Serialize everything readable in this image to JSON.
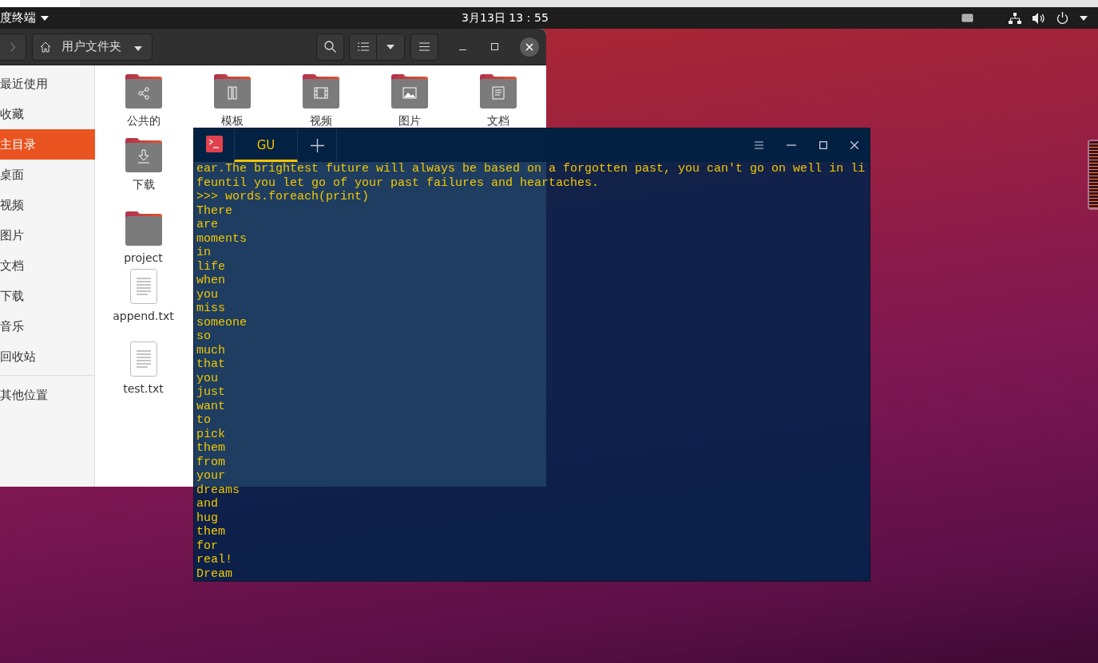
{
  "top_bar": {
    "app_menu": "度终端",
    "clock": "3月13日  13：55"
  },
  "file_manager": {
    "location": "用户文件夹",
    "sidebar": [
      {
        "label": "最近使用",
        "selected": false
      },
      {
        "label": "收藏",
        "selected": false
      },
      {
        "label": "主目录",
        "selected": true
      },
      {
        "label": "桌面",
        "selected": false
      },
      {
        "label": "视频",
        "selected": false
      },
      {
        "label": "图片",
        "selected": false
      },
      {
        "label": "文档",
        "selected": false
      },
      {
        "label": "下载",
        "selected": false
      },
      {
        "label": "音乐",
        "selected": false
      },
      {
        "label": "回收站",
        "selected": false
      },
      {
        "label": "其他位置",
        "selected": false
      }
    ],
    "files": [
      {
        "name": "公共的",
        "kind": "shared"
      },
      {
        "name": "模板",
        "kind": "templates"
      },
      {
        "name": "视频",
        "kind": "videos"
      },
      {
        "name": "图片",
        "kind": "pictures"
      },
      {
        "name": "文档",
        "kind": "documents"
      },
      {
        "name": "下载",
        "kind": "downloads"
      },
      {
        "name": "project",
        "kind": "folder"
      },
      {
        "name": "append.txt",
        "kind": "text"
      },
      {
        "name": "test.txt",
        "kind": "text"
      }
    ]
  },
  "terminal": {
    "tabs": [
      {
        "label": "GU",
        "selected": true
      }
    ],
    "lines": [
      "ear.The brightest future will always be based on a forgotten past, you can't go on well in li",
      "feuntil you let go of your past failures and heartaches.",
      ">>> words.foreach(print)",
      "There",
      "are",
      "moments",
      "in",
      "life",
      "when",
      "you",
      "miss",
      "someone",
      "so",
      "much",
      "that",
      "you",
      "just",
      "want",
      "to",
      "pick",
      "them",
      "from",
      "your",
      "dreams",
      "and",
      "hug",
      "them",
      "for",
      "real!",
      "Dream"
    ]
  }
}
